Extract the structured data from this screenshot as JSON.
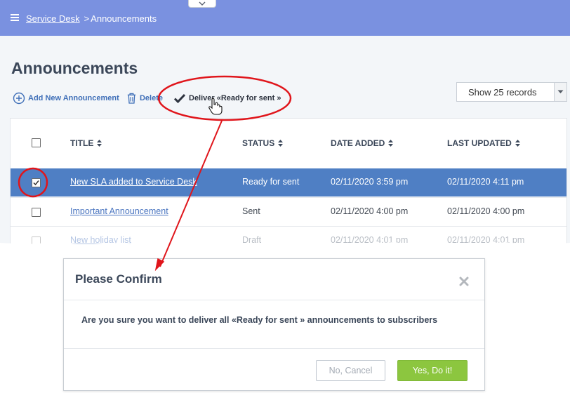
{
  "header": {
    "breadcrumb_root": "Service Desk",
    "breadcrumb_separator": ">",
    "breadcrumb_current": "Announcements"
  },
  "page": {
    "title": "Announcements"
  },
  "toolbar": {
    "add_label": "Add New Announcement",
    "delete_label": "Delete",
    "deliver_label": "Deliver «Ready for sent »",
    "records_value": "Show 25 records"
  },
  "table": {
    "columns": [
      "TITLE",
      "STATUS",
      "DATE ADDED",
      "LAST UPDATED"
    ],
    "rows": [
      {
        "title": "New SLA added to Service Desk",
        "status": "Ready for sent",
        "date_added": "02/11/2020 3:59 pm",
        "last_updated": "02/11/2020 4:11 pm",
        "checked": true
      },
      {
        "title": "Important Announcement",
        "status": "Sent",
        "date_added": "02/11/2020 4:00 pm",
        "last_updated": "02/11/2020 4:00 pm",
        "checked": false
      },
      {
        "title": "New holiday list",
        "status": "Draft",
        "date_added": "02/11/2020 4:01 pm",
        "last_updated": "02/11/2020 4:01 pm",
        "checked": false
      }
    ]
  },
  "dialog": {
    "title": "Please Confirm",
    "message": "Are you sure you want to deliver all «Ready for sent » announcements to subscribers",
    "cancel_label": "No, Cancel",
    "confirm_label": "Yes, Do it!"
  },
  "colors": {
    "header": "#7a91e0",
    "selected_row": "#4f7fc4",
    "link": "#4a75c0",
    "confirm_button": "#8cc63f",
    "annotation": "#e0151b"
  },
  "icons": [
    "menu-icon",
    "chevron-down-icon",
    "add-circle-icon",
    "trash-icon",
    "checkmark-icon",
    "hand-cursor-icon",
    "sort-icon",
    "close-icon"
  ]
}
